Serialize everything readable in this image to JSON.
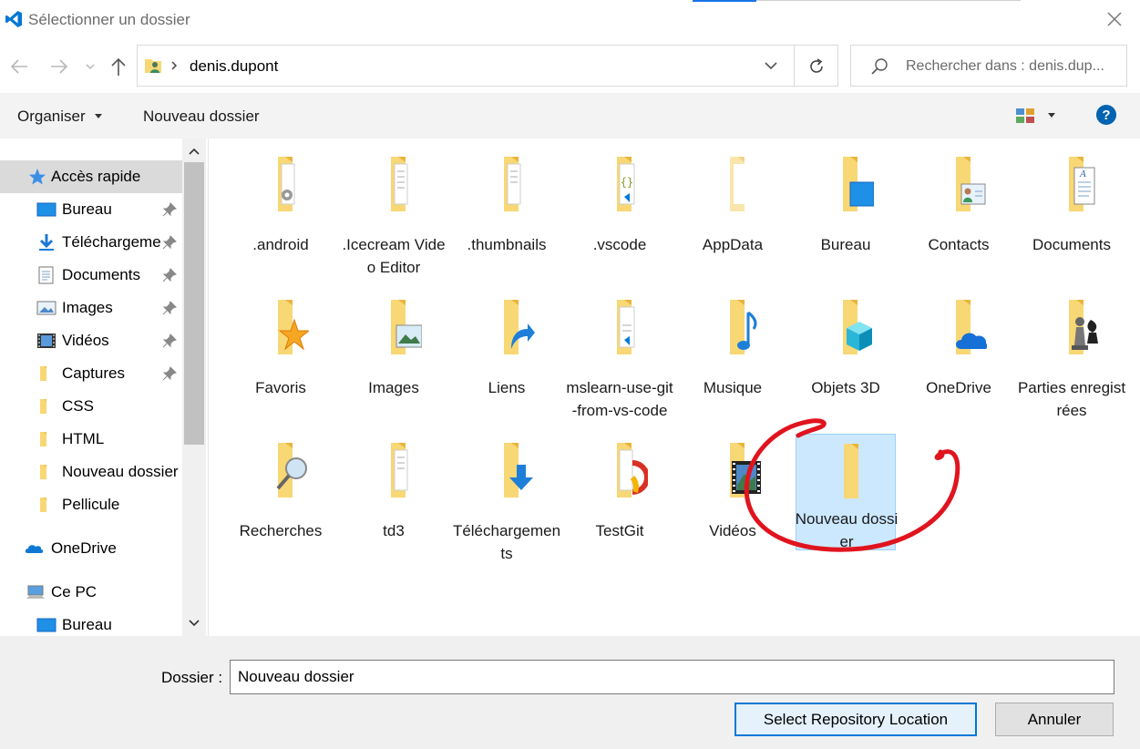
{
  "window": {
    "title": "Sélectionner un dossier"
  },
  "address": {
    "path": "denis.dupont"
  },
  "search": {
    "placeholder": "Rechercher dans : denis.dup..."
  },
  "toolbar": {
    "organize_label": "Organiser",
    "new_folder_label": "Nouveau dossier"
  },
  "sidebar": {
    "items": [
      {
        "label": "Accès rapide",
        "icon": "star-icon"
      },
      {
        "label": "Bureau",
        "icon": "desktop-icon",
        "pinned": true
      },
      {
        "label": "Téléchargeme",
        "icon": "download-icon",
        "pinned": true
      },
      {
        "label": "Documents",
        "icon": "documents-icon",
        "pinned": true
      },
      {
        "label": "Images",
        "icon": "images-icon",
        "pinned": true
      },
      {
        "label": "Vidéos",
        "icon": "videos-icon",
        "pinned": true
      },
      {
        "label": "Captures",
        "icon": "folder-icon",
        "pinned": true
      },
      {
        "label": "CSS",
        "icon": "folder-icon"
      },
      {
        "label": "HTML",
        "icon": "folder-icon"
      },
      {
        "label": "Nouveau dossier",
        "icon": "folder-icon"
      },
      {
        "label": "Pellicule",
        "icon": "folder-icon"
      },
      {
        "label": "OneDrive",
        "icon": "onedrive-icon"
      },
      {
        "label": "Ce PC",
        "icon": "computer-icon"
      },
      {
        "label": "Bureau",
        "icon": "desktop-icon"
      }
    ]
  },
  "folders": [
    {
      "name": ".android",
      "overlay": "gear"
    },
    {
      "name": ".Icecream Video Editor",
      "overlay": "doc"
    },
    {
      "name": ".thumbnails",
      "overlay": "doc"
    },
    {
      "name": ".vscode",
      "overlay": "vscode"
    },
    {
      "name": "AppData",
      "overlay": "hidden"
    },
    {
      "name": "Bureau",
      "overlay": "desktop"
    },
    {
      "name": "Contacts",
      "overlay": "contact"
    },
    {
      "name": "Documents",
      "overlay": "document"
    },
    {
      "name": "Favoris",
      "overlay": "star"
    },
    {
      "name": "Images",
      "overlay": "picture"
    },
    {
      "name": "Liens",
      "overlay": "arrow"
    },
    {
      "name": "mslearn-use-git-from-vs-code",
      "overlay": "vscode"
    },
    {
      "name": "Musique",
      "overlay": "music"
    },
    {
      "name": "Objets 3D",
      "overlay": "cube"
    },
    {
      "name": "OneDrive",
      "overlay": "cloud"
    },
    {
      "name": "Parties enregistrées",
      "overlay": "chess"
    },
    {
      "name": "Recherches",
      "overlay": "magnifier"
    },
    {
      "name": "td3",
      "overlay": "doc"
    },
    {
      "name": "Téléchargements",
      "overlay": "download"
    },
    {
      "name": "TestGit",
      "overlay": "chrome"
    },
    {
      "name": "Vidéos",
      "overlay": "film"
    },
    {
      "name": "Nouveau dossier",
      "overlay": "none",
      "selected": true
    }
  ],
  "footer": {
    "folder_label": "Dossier :",
    "folder_value": "Nouveau dossier",
    "select_label": "Select Repository Location",
    "cancel_label": "Annuler"
  },
  "colors": {
    "accent": "#0078d7",
    "selection": "#cce8ff",
    "folder": "#f8d775",
    "annotation": "#e0141e"
  }
}
